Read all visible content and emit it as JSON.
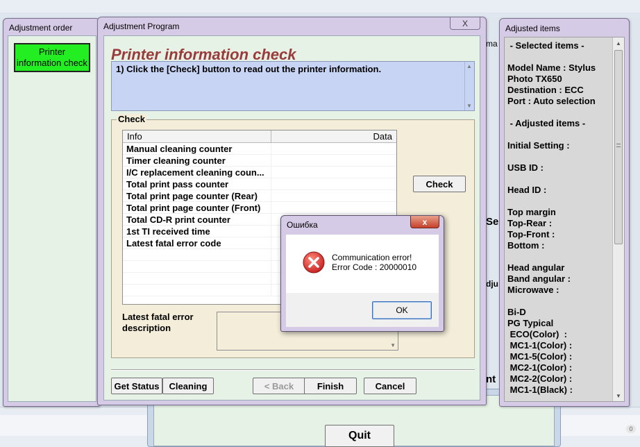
{
  "background": {
    "quit_label": "Quit",
    "peek_ma": "ma",
    "peek_sel": "Sel",
    "peek_dju": "dju",
    "peek_nt": "nt",
    "peek_badge": "0"
  },
  "order_window": {
    "title": "Adjustment order",
    "button_label": "Printer information check"
  },
  "program_window": {
    "title": "Adjustment Program",
    "close_glyph": "X",
    "heading": "Printer information check",
    "instruction": "1) Click the [Check] button to read out the printer information.",
    "check_group_label": "Check",
    "table": {
      "headers": [
        "Info",
        "Data"
      ],
      "rows": [
        "Manual cleaning counter",
        "Timer cleaning counter",
        "I/C replacement cleaning coun...",
        "Total print pass counter",
        "Total print page counter (Rear)",
        "Total print page counter (Front)",
        "Total CD-R print counter",
        "1st TI received time",
        "Latest fatal error code"
      ]
    },
    "check_button": "Check",
    "fatal_label": "Latest fatal error description",
    "buttons": {
      "get_status": "Get Status",
      "cleaning": "Cleaning",
      "back": "< Back",
      "finish": "Finish",
      "cancel": "Cancel"
    }
  },
  "items_window": {
    "title": "Adjusted items",
    "text": " - Selected items -\n\nModel Name : Stylus\nPhoto TX650\nDestination : ECC\nPort : Auto selection\n\n - Adjusted items -\n\nInitial Setting :\n\nUSB ID :\n\nHead ID :\n\nTop margin\nTop-Rear :\nTop-Front :\nBottom :\n\nHead angular\nBand angular :\nMicrowave :\n\nBi-D\nPG Typical\n ECO(Color)  :\n MC1-1(Color) :\n MC1-5(Color) :\n MC2-1(Color) :\n MC2-2(Color) :\n MC1-1(Black) :"
  },
  "error_dialog": {
    "title": "Ошибка",
    "close_glyph": "x",
    "message_line1": "Communication error!",
    "message_line2": "Error Code : 20000010",
    "ok_label": "OK",
    "icon": "error-icon",
    "icon_color": "#d42a2a"
  }
}
